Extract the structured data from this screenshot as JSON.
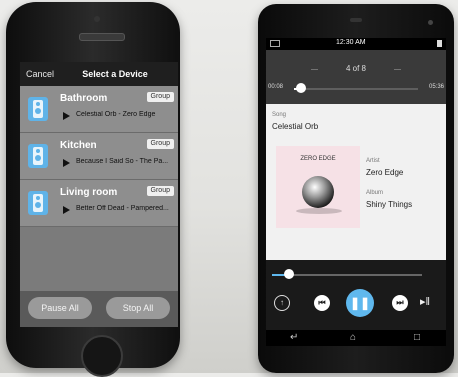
{
  "ios": {
    "cancel_label": "Cancel",
    "title": "Select a Device",
    "devices": [
      {
        "name": "Bathroom",
        "badge": "Group",
        "track": "Celestial Orb - Zero Edge"
      },
      {
        "name": "Kitchen",
        "badge": "Group",
        "track": "Because I Said So - The Pa..."
      },
      {
        "name": "Living room",
        "badge": "Group",
        "track": "Better Off Dead - Pampered..."
      }
    ],
    "pause_all_label": "Pause All",
    "stop_all_label": "Stop All"
  },
  "android": {
    "status_time": "12:30 AM",
    "track_count": "4 of 8",
    "elapsed": "00:08",
    "total": "05:36",
    "progress_fraction": 0.06,
    "volume_fraction": 0.11,
    "song_label": "Song",
    "song": "Celestial Orb",
    "artist_label": "Artist",
    "artist": "Zero Edge",
    "album_label": "Album",
    "album": "Shiny Things",
    "album_art_text": "ZERO EDGE",
    "accent_color": "#5fb8ee"
  }
}
